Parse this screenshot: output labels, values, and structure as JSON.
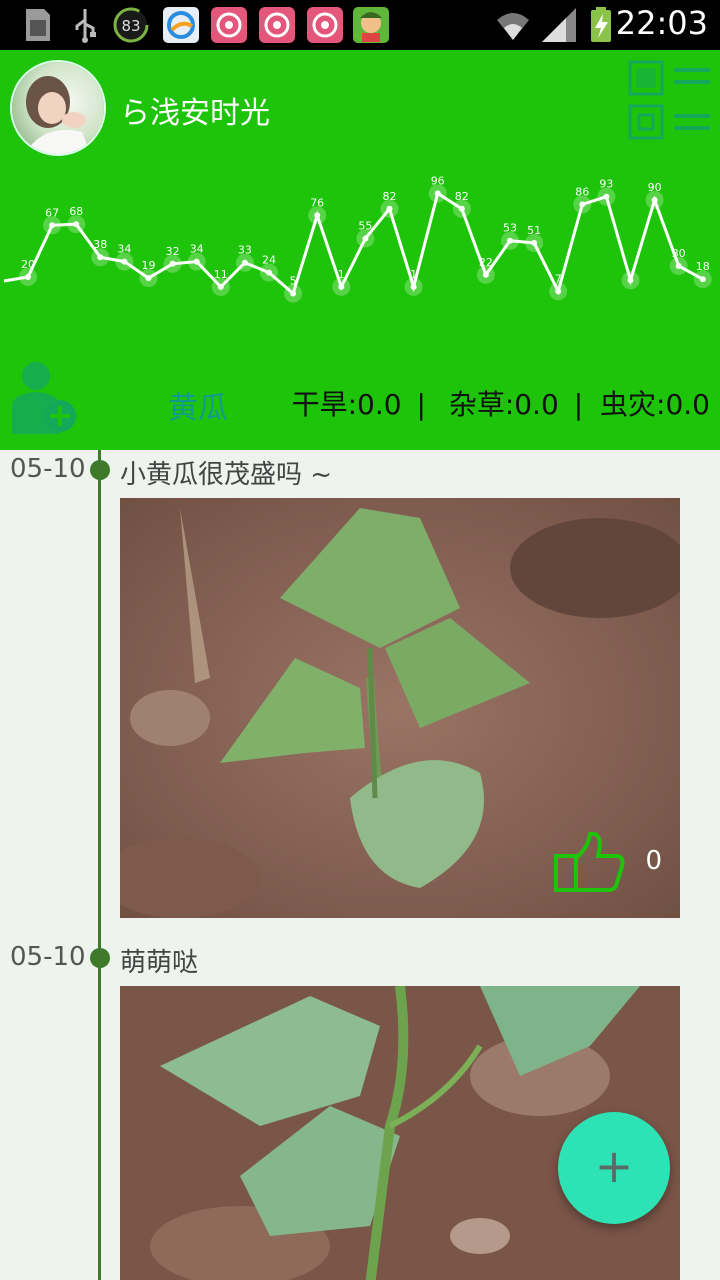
{
  "status_bar": {
    "battery_level": "83",
    "time": "22:03"
  },
  "header": {
    "username": "ら浅安时光",
    "crop_name": "黄瓜",
    "stats": {
      "drought": "干旱:0.0",
      "weeds": "杂草:0.0",
      "pests": "虫灾:0.0",
      "sep": "|"
    }
  },
  "chart_data": {
    "type": "line",
    "values": [
      20,
      67,
      68,
      38,
      34,
      19,
      32,
      34,
      11,
      33,
      24,
      5,
      76,
      11,
      55,
      82,
      11,
      96,
      82,
      22,
      53,
      51,
      7,
      86,
      93,
      17,
      90,
      30,
      18
    ],
    "point_labels": [
      "20",
      "67",
      "68",
      "38",
      "34",
      "19",
      "32",
      "34",
      "11",
      "33",
      "24",
      "5",
      "76",
      "1",
      "55",
      "82",
      "1",
      "96",
      "82",
      "22",
      "53",
      "51",
      "7",
      "86",
      "93",
      "",
      "90",
      "30",
      "18"
    ],
    "grid": false,
    "line_color": "#ffffff"
  },
  "posts": [
    {
      "date": "05-10",
      "text": "小黄瓜很茂盛吗 ~",
      "likes": "0"
    },
    {
      "date": "05-10",
      "text": "萌萌哒"
    }
  ],
  "fab": {
    "label": "+"
  },
  "colors": {
    "header_bg": "#1ec40a",
    "timeline_bg": "#eef3ee",
    "timeline_line": "#3e7a2a",
    "crop_name": "#0f9a92",
    "fab": "#2de3b5"
  }
}
